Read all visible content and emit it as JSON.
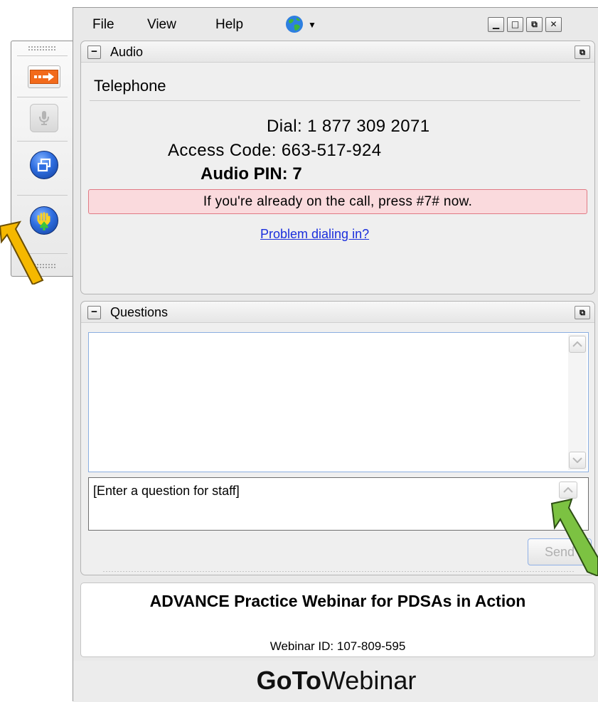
{
  "menubar": {
    "items": [
      "File",
      "View",
      "Help"
    ],
    "window_controls": [
      "minimize",
      "maximize",
      "restore",
      "close"
    ]
  },
  "audio": {
    "title": "Audio",
    "mode": "Telephone",
    "dial": "Dial: 1 877 309 2071",
    "access_code": "Access Code: 663-517-924",
    "audio_pin": "Audio PIN: 7",
    "notice": "If you're already on the call, press #7# now.",
    "problem_link": "Problem dialing in?"
  },
  "questions": {
    "title": "Questions",
    "input_placeholder": "[Enter a question for staff]",
    "send_label": "Send"
  },
  "webinar": {
    "title": "ADVANCE Practice Webinar for PDSAs in Action",
    "id_text": "Webinar ID: 107-809-595",
    "brand_bold": "GoTo",
    "brand_rest": "Webinar"
  },
  "colors": {
    "arrow_left": "#f5b800",
    "arrow_right": "#7cc242",
    "notice_bg": "#fadadd",
    "link": "#1a2edc"
  }
}
